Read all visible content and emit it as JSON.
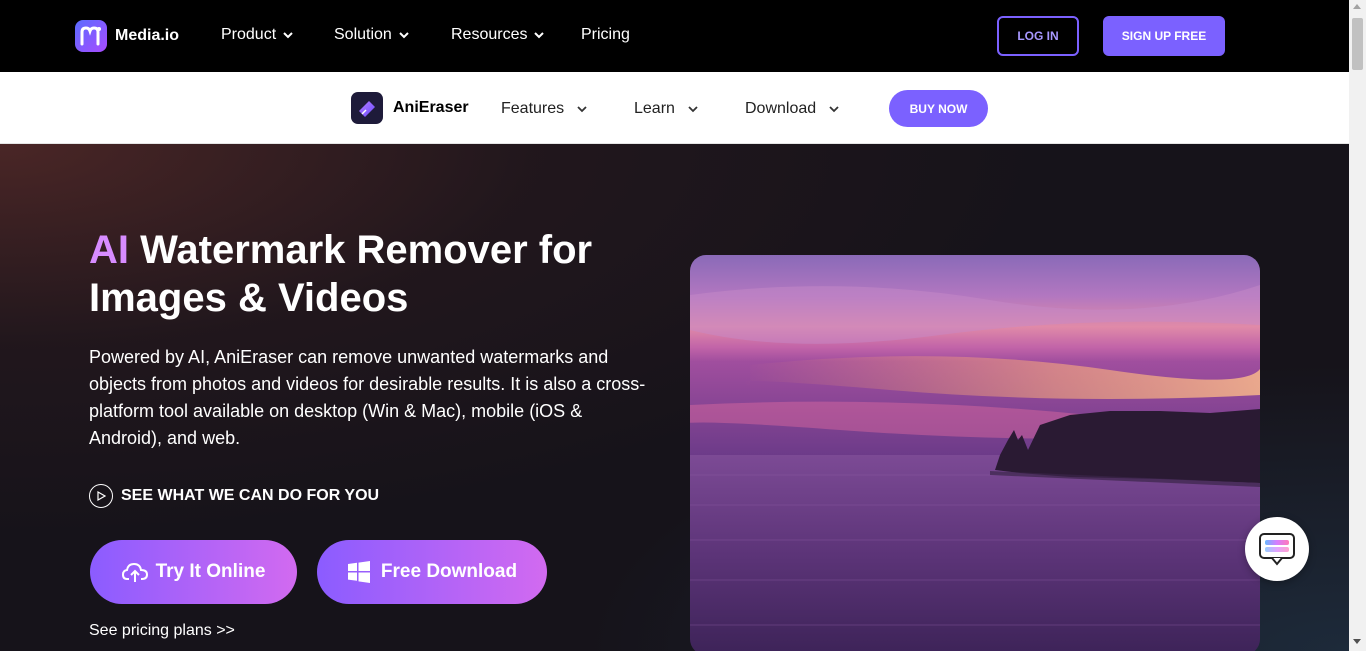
{
  "topnav": {
    "logo_text": "Media.io",
    "items": [
      {
        "label": "Product"
      },
      {
        "label": "Solution"
      },
      {
        "label": "Resources"
      },
      {
        "label": "Pricing"
      }
    ],
    "login_label": "LOG IN",
    "signup_label": "SIGN UP FREE"
  },
  "subnav": {
    "product_name": "AniEraser",
    "items": [
      {
        "label": "Features"
      },
      {
        "label": "Learn"
      },
      {
        "label": "Download"
      }
    ],
    "buy_label": "BUY NOW"
  },
  "hero": {
    "title_ai": "AI",
    "title_rest": " Watermark Remover for Images & Videos",
    "description": "Powered by AI, AniEraser can remove unwanted watermarks and objects from photos and videos for desirable results. It is also a cross-platform tool available on desktop (Win & Mac), mobile (iOS & Android), and web.",
    "see_what_label": "SEE WHAT WE CAN DO FOR YOU",
    "try_label": "Try It Online",
    "download_label": "Free Download",
    "pricing_label": "See pricing plans >>"
  },
  "colors": {
    "accent": "#7b61ff",
    "ai_highlight": "#d78cff",
    "topnav_bg": "#000000",
    "hero_bg": "#16131a"
  }
}
